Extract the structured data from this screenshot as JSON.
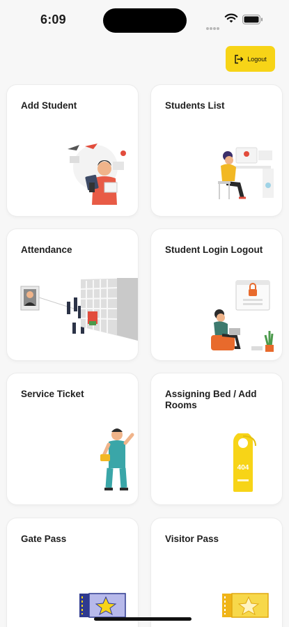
{
  "status_bar": {
    "time": "6:09"
  },
  "header": {
    "logout_label": "Logout"
  },
  "cards": [
    {
      "title": "Add Student"
    },
    {
      "title": "Students List"
    },
    {
      "title": "Attendance"
    },
    {
      "title": "Student Login Logout"
    },
    {
      "title": "Service Ticket"
    },
    {
      "title": "Assigning Bed / Add Rooms"
    },
    {
      "title": "Gate Pass"
    },
    {
      "title": "Visitor Pass"
    }
  ],
  "illustrations": {
    "door_hanger_number": "404"
  },
  "colors": {
    "accent": "#f7d417",
    "background": "#f7f7f7",
    "card": "#ffffff"
  }
}
